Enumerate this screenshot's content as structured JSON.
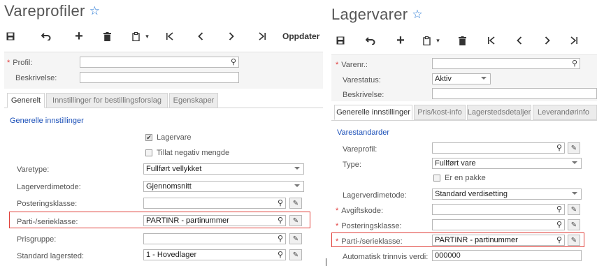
{
  "left": {
    "title": "Vareprofiler",
    "toolbar": {
      "update_label": "Oppdater"
    },
    "header": {
      "profile_label": "Profil:",
      "description_label": "Beskrivelse:"
    },
    "tabs": [
      {
        "label": "Generelt"
      },
      {
        "label": "Innstillinger for bestillingsforslag"
      },
      {
        "label": "Egenskaper"
      }
    ],
    "section_title": "Generelle innstillinger",
    "stock_item_label": "Lagervare",
    "allow_negative_label": "Tillat negativ mengde",
    "fields": {
      "item_type": {
        "label": "Varetype:",
        "value": "Fullført vellykket"
      },
      "valuation": {
        "label": "Lagerverdimetode:",
        "value": "Gjennomsnitt"
      },
      "posting_class": {
        "label": "Posteringsklasse:",
        "value": ""
      },
      "lot_serial": {
        "label": "Parti-/serieklasse:",
        "value": "PARTINR - partinummer"
      },
      "price_group": {
        "label": "Prisgruppe:",
        "value": ""
      },
      "default_warehouse": {
        "label": "Standard lagersted:",
        "value": "1 - Hovedlager"
      }
    }
  },
  "right": {
    "title": "Lagervarer",
    "header": {
      "item_no_label": "Varenr.:",
      "status_label": "Varestatus:",
      "status_value": "Aktiv",
      "description_label": "Beskrivelse:"
    },
    "tabs": [
      {
        "label": "Generelle innstillinger"
      },
      {
        "label": "Pris/kost-info"
      },
      {
        "label": "Lagerstedsdetaljer"
      },
      {
        "label": "Leverandørinfo"
      }
    ],
    "section_title": "Varestandarder",
    "package_label": "Er en pakke",
    "fields": {
      "item_profile": {
        "label": "Vareprofil:",
        "value": ""
      },
      "type": {
        "label": "Type:",
        "value": "Fullført vare"
      },
      "valuation": {
        "label": "Lagerverdimetode:",
        "value": "Standard verdisetting"
      },
      "tax_code": {
        "label": "Avgiftskode:",
        "value": ""
      },
      "posting_class": {
        "label": "Posteringsklasse:",
        "value": ""
      },
      "lot_serial": {
        "label": "Parti-/serieklasse:",
        "value": "PARTINR - partinummer"
      },
      "auto_increment": {
        "label": "Automatisk trinnvis verdi:",
        "value": "000000"
      }
    }
  }
}
